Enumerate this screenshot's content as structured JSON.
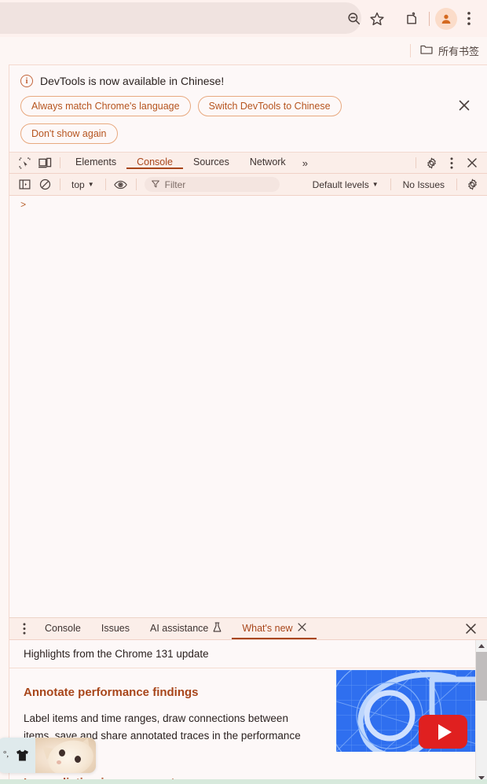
{
  "browser": {
    "toolbar_icons": [
      "zoom-out-icon",
      "bookmark-star-icon",
      "extensions-icon",
      "profile-avatar-icon",
      "chrome-menu-icon"
    ],
    "bookmark_bar": {
      "all_bookmarks_label": "所有书签",
      "folder_icon": "folder-icon"
    }
  },
  "devtools": {
    "language_banner": {
      "info_icon": "info-icon",
      "title": "DevTools is now available in Chinese!",
      "buttons": [
        "Always match Chrome's language",
        "Switch DevTools to Chinese",
        "Don't show again"
      ],
      "close_icon": "close-icon"
    },
    "tab_strip": {
      "inspect_icon": "inspect-element-icon",
      "device_icon": "device-toolbar-icon",
      "tabs": [
        {
          "label": "Elements",
          "active": false
        },
        {
          "label": "Console",
          "active": true
        },
        {
          "label": "Sources",
          "active": false
        },
        {
          "label": "Network",
          "active": false
        }
      ],
      "more_tabs_label": "»",
      "settings_icon": "gear-icon",
      "more_options_icon": "kebab-menu-icon",
      "close_icon": "close-icon"
    },
    "console_toolbar": {
      "sidebar_toggle_icon": "show-console-sidebar-icon",
      "clear_icon": "clear-console-icon",
      "context_label": "top",
      "eye_icon": "live-expression-icon",
      "filter_icon": "filter-icon",
      "filter_placeholder": "Filter",
      "filter_value": "",
      "levels_label": "Default levels",
      "issues_label": "No Issues",
      "settings_icon": "gear-icon"
    },
    "console_body": {
      "prompt_symbol": ">"
    },
    "drawer": {
      "menu_icon": "kebab-menu-icon",
      "tabs": [
        {
          "label": "Console",
          "active": false,
          "icon": null,
          "closeable": false
        },
        {
          "label": "Issues",
          "active": false,
          "icon": null,
          "closeable": false
        },
        {
          "label": "AI assistance",
          "active": false,
          "icon": "flask-icon",
          "closeable": false
        },
        {
          "label": "What's new",
          "active": true,
          "icon": null,
          "closeable": true
        }
      ],
      "close_icon": "close-icon",
      "whats_new": {
        "highlight_line": "Highlights from the Chrome 131 update",
        "sections": [
          {
            "heading": "Annotate performance findings",
            "body": "Label items and time ranges, draw connections between items, save and share annotated traces in the performance panel.",
            "thumbnail": {
              "type": "youtube-video-thumbnail",
              "play_icon": "youtube-play-icon",
              "background_color": "#2f6fef"
            }
          },
          {
            "heading": "Ignore listing improvements",
            "body": ""
          }
        ]
      },
      "scrollbar": {
        "up_arrow_icon": "scroll-up-arrow-icon",
        "down_arrow_icon": "scroll-down-arrow-icon"
      }
    }
  },
  "overlay_popup": {
    "glyph_text": "°,",
    "shirt_icon": "tshirt-icon",
    "thumbnail": "cat-photo-thumbnail"
  },
  "colors": {
    "accent": "#a8461b",
    "banner_border": "#e8a97f",
    "background": "#fdf8f8",
    "chrome_toolbar": "#fdf1ee",
    "youtube_red": "#e02020",
    "thumb_blue": "#2f6fef"
  }
}
